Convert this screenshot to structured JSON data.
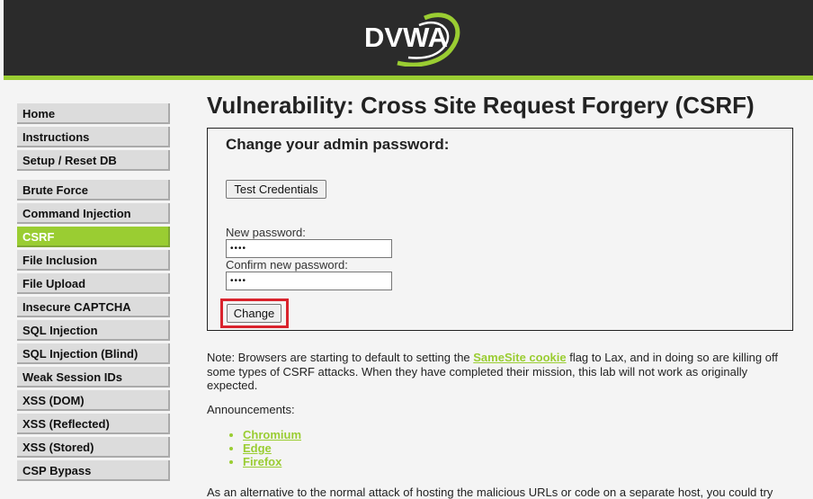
{
  "header": {
    "logo_text": "DVWA",
    "colors": {
      "background": "#2b2b2b",
      "accent": "#9acd32"
    }
  },
  "sidebar": {
    "groups": [
      [
        {
          "label": "Home"
        },
        {
          "label": "Instructions"
        },
        {
          "label": "Setup / Reset DB"
        }
      ],
      [
        {
          "label": "Brute Force"
        },
        {
          "label": "Command Injection"
        },
        {
          "label": "CSRF",
          "selected": true
        },
        {
          "label": "File Inclusion"
        },
        {
          "label": "File Upload"
        },
        {
          "label": "Insecure CAPTCHA"
        },
        {
          "label": "SQL Injection"
        },
        {
          "label": "SQL Injection (Blind)"
        },
        {
          "label": "Weak Session IDs"
        },
        {
          "label": "XSS (DOM)"
        },
        {
          "label": "XSS (Reflected)"
        },
        {
          "label": "XSS (Stored)"
        },
        {
          "label": "CSP Bypass"
        }
      ]
    ]
  },
  "main": {
    "title": "Vulnerability: Cross Site Request Forgery (CSRF)",
    "form": {
      "heading": "Change your admin password:",
      "test_button": "Test Credentials",
      "new_password_label": "New password:",
      "new_password_value": "••••",
      "confirm_password_label": "Confirm new password:",
      "confirm_password_value": "••••",
      "change_button": "Change",
      "highlight_color": "#d9232d"
    },
    "note": {
      "prefix": "Note: Browsers are starting to default to setting the ",
      "link": "SameSite cookie",
      "suffix": " flag to Lax, and in doing so are killing off some types of CSRF attacks. When they have completed their mission, this lab will not work as originally expected."
    },
    "announcements_title": "Announcements:",
    "announcements": [
      "Chromium",
      "Edge",
      "Firefox"
    ],
    "bottom_text": "As an alternative to the normal attack of hosting the malicious URLs or code on a separate host, you could try"
  }
}
